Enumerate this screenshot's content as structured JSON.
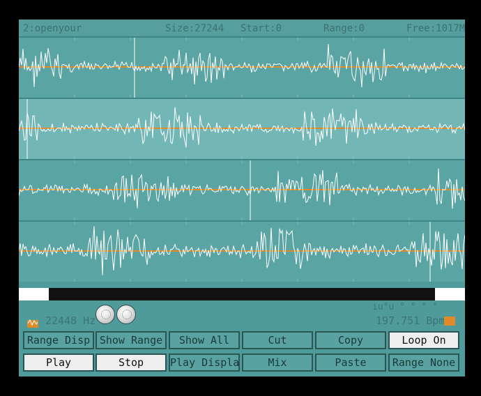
{
  "header": {
    "file": "2:openyour",
    "size": "Size:27244",
    "start": "Start:0",
    "range": "Range:0",
    "free": "Free:1017M"
  },
  "tracks": [
    {
      "id": 1,
      "selected": false
    },
    {
      "id": 2,
      "selected": true
    },
    {
      "id": 3,
      "selected": false
    },
    {
      "id": 4,
      "selected": false
    }
  ],
  "status": {
    "rate": "22448 Hz",
    "dots": "ıu°u  °  °  °  °",
    "bpm": "197.751 Bpm"
  },
  "buttons": {
    "row1": [
      "Range Disp",
      "Show Range",
      "Show All",
      "Cut",
      "Copy",
      "Loop On"
    ],
    "row2": [
      "Play",
      "Stop",
      "Play Display",
      "Mix",
      "Paste",
      "Range None"
    ]
  },
  "icons": [
    "waveform-icon",
    "orange-square-icon",
    "knob-icon"
  ],
  "colors": {
    "background": "#4f9a9a",
    "wave": "#ffffff",
    "center_line": "#e08a2a",
    "active_button": "#eeeeee"
  }
}
